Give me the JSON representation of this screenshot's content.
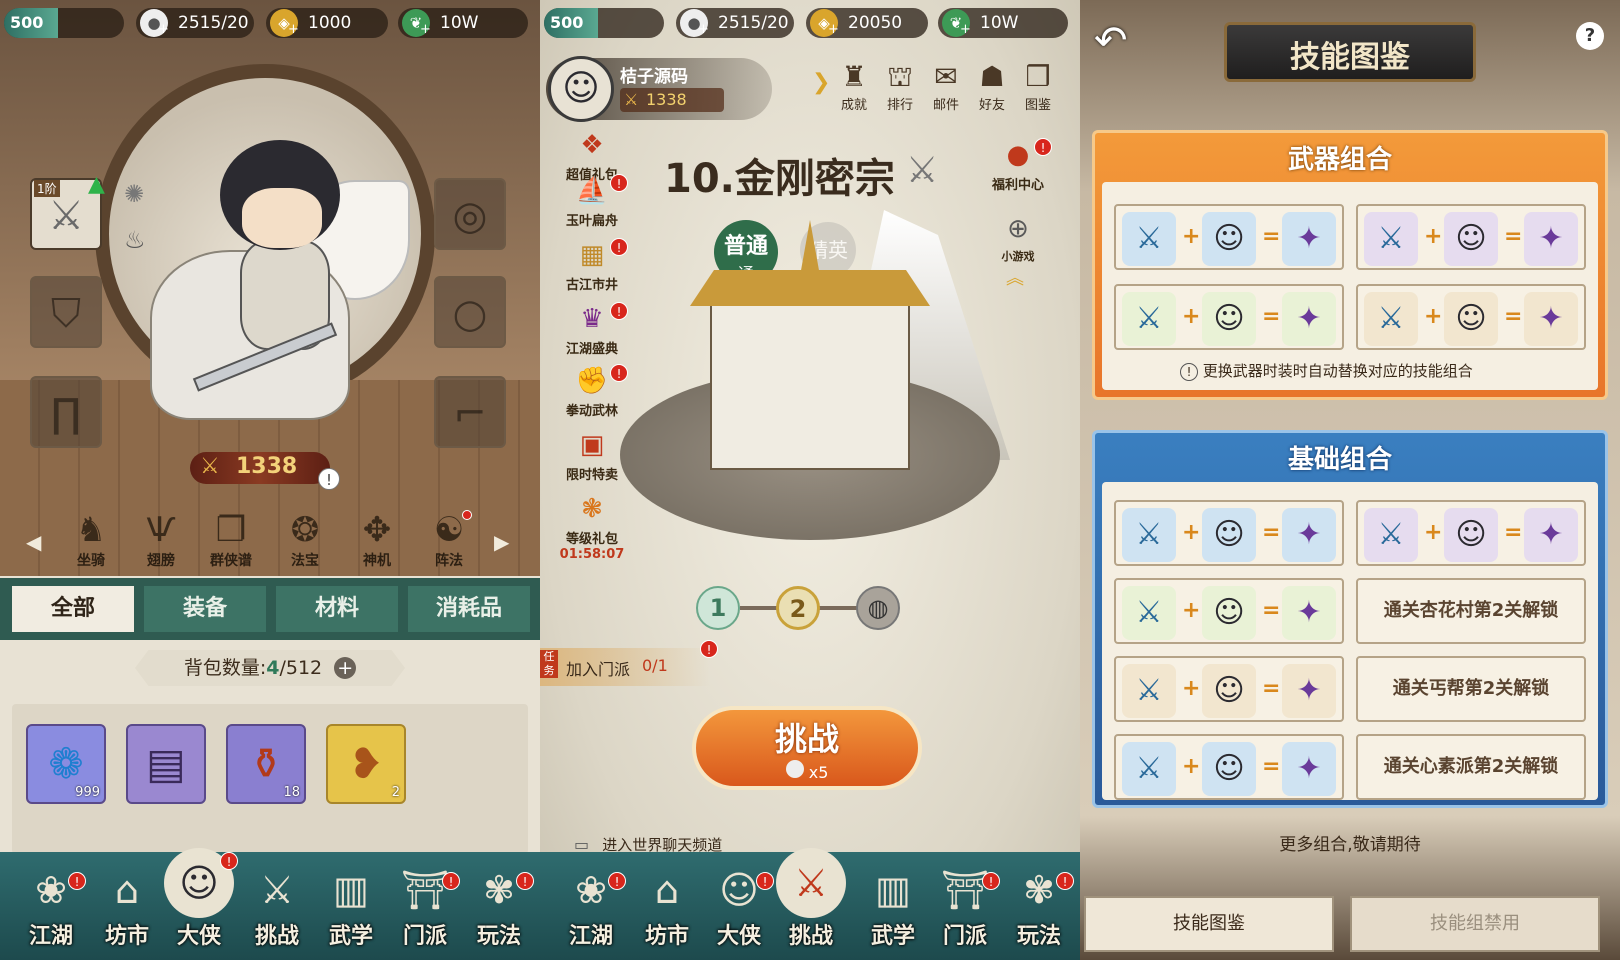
{
  "panel1": {
    "level": {
      "value": "500",
      "progress": 0.45
    },
    "resources": [
      {
        "icon": "bun-icon",
        "value": "2515/20"
      },
      {
        "icon": "coin-icon",
        "value": "1000"
      },
      {
        "icon": "jade-leaf-icon",
        "value": "10W"
      }
    ],
    "weapon_slot_tier": "1阶",
    "power": "1338",
    "menu": [
      "坐骑",
      "翅膀",
      "群侠谱",
      "法宝",
      "神机",
      "阵法"
    ],
    "tabs": [
      "全部",
      "装备",
      "材料",
      "消耗品"
    ],
    "bag_label": "背包数量:",
    "bag_used": "4",
    "bag_total": "/512",
    "items": [
      {
        "name": "blue-spirit-item",
        "count": "999",
        "color": "#8a8ce0"
      },
      {
        "name": "purple-scroll-item",
        "count": "",
        "color": "#9a88d0"
      },
      {
        "name": "wine-jar-item",
        "count": "18",
        "color": "#8a7fd0"
      },
      {
        "name": "roast-chicken-item",
        "count": "2",
        "color": "#e6c44a"
      }
    ]
  },
  "navbar": [
    "江湖",
    "坊市",
    "大侠",
    "挑战",
    "武学",
    "门派",
    "玩法"
  ],
  "panel2": {
    "level": {
      "value": "500",
      "progress": 0.45
    },
    "resources": [
      {
        "icon": "bun-icon",
        "value": "2515/20"
      },
      {
        "icon": "coin-icon",
        "value": "20050"
      },
      {
        "icon": "jade-leaf-icon",
        "value": "10W"
      }
    ],
    "player_name": "桔子源码",
    "player_power": "1338",
    "top_icons": [
      "成就",
      "排行",
      "邮件",
      "好友",
      "图鉴"
    ],
    "side_events": [
      "超值礼包",
      "玉叶扁舟",
      "古江市井",
      "江湖盛典",
      "拳动武林",
      "限时特卖",
      "等级礼包"
    ],
    "level_gift_timer": "01:58:07",
    "right_events": [
      "福利中心",
      "小游戏"
    ],
    "stage_title": "10.金刚密宗",
    "difficulty_normal": "普通",
    "difficulty_normal_sub": "通",
    "difficulty_elite": "精英",
    "stages": [
      "1",
      "2"
    ],
    "task_tag": "任务",
    "task_text": "加入门派",
    "task_progress": "0/1",
    "challenge_label": "挑战",
    "challenge_cost": "x5",
    "chat_hint": "进入世界聊天频道"
  },
  "panel3": {
    "title": "技能图鉴",
    "help": "?",
    "section_weapon": "武器组合",
    "weapon_note": "更换武器时装时自动替换对应的技能组合",
    "section_basic": "基础组合",
    "locked": [
      "通关杏花村第2关解锁",
      "通关丐帮第2关解锁",
      "通关心素派第2关解锁"
    ],
    "more": "更多组合,敬请期待",
    "bottom_tabs": [
      "技能图鉴",
      "技能组禁用"
    ]
  }
}
